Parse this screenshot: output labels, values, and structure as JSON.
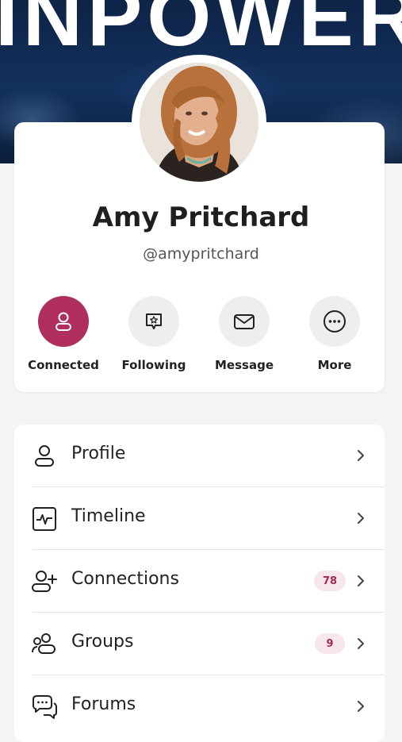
{
  "banner": {
    "text": "INPOWER"
  },
  "profile": {
    "name": "Amy Pritchard",
    "handle": "@amypritchard"
  },
  "actions": [
    {
      "label": "Connected",
      "icon": "person-icon",
      "active": true
    },
    {
      "label": "Following",
      "icon": "star-chat-icon",
      "active": false
    },
    {
      "label": "Message",
      "icon": "envelope-icon",
      "active": false
    },
    {
      "label": "More",
      "icon": "more-dots-icon",
      "active": false
    }
  ],
  "menu": [
    {
      "label": "Profile",
      "icon": "person-outline-icon"
    },
    {
      "label": "Timeline",
      "icon": "activity-pulse-icon"
    },
    {
      "label": "Connections",
      "icon": "person-add-icon",
      "badge": "78"
    },
    {
      "label": "Groups",
      "icon": "group-icon",
      "badge": "9"
    },
    {
      "label": "Forums",
      "icon": "chat-bubbles-icon"
    }
  ],
  "colors": {
    "accent": "#b02e5d",
    "badge_bg": "#f7e6ec",
    "badge_text": "#a32a55",
    "banner": "#13305c"
  }
}
